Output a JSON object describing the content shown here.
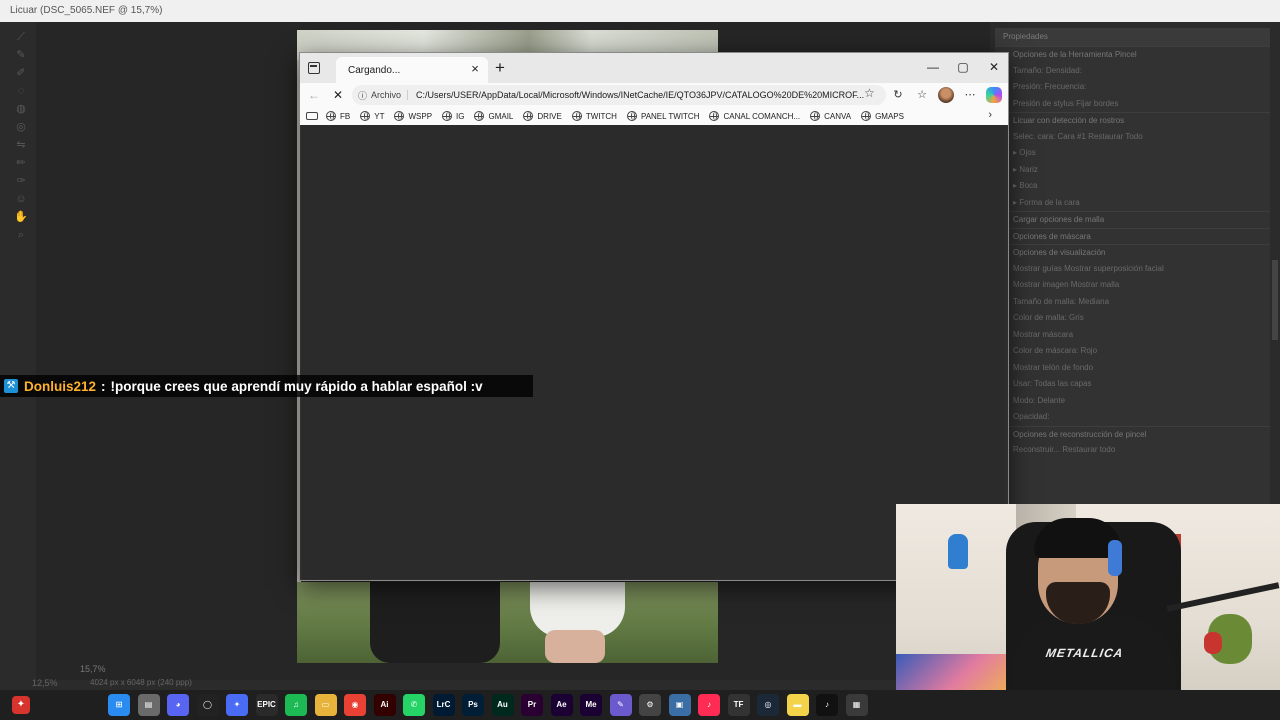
{
  "photoshop": {
    "title": "Licuar (DSC_5065.NEF @ 15,7%)",
    "zoom": "12,5%",
    "zoom_field": "15,7%",
    "doc_info": "4024 px x 6048 px (240 ppp)",
    "panel": {
      "header": "Propiedades",
      "rows": [
        {
          "text": "Opciones de la Herramienta Pincel",
          "section": true
        },
        {
          "text": "Tamaño:            Densidad:",
          "section": false
        },
        {
          "text": "Presión:            Frecuencia:",
          "section": false
        },
        {
          "text": "Presión de stylus                        Fijar bordes",
          "section": false
        },
        {
          "text": "Licuar con detección de rostros",
          "section": true
        },
        {
          "text": "Selec. cara:   Cara #1        Restaurar   Todo",
          "section": false
        },
        {
          "text": "▸ Ojos",
          "section": false
        },
        {
          "text": "▸ Nariz",
          "section": false
        },
        {
          "text": "▸ Boca",
          "section": false
        },
        {
          "text": "▸ Forma de la cara",
          "section": false
        },
        {
          "text": "Cargar opciones de malla",
          "section": true
        },
        {
          "text": "Opciones de máscara",
          "section": true
        },
        {
          "text": "Opciones de visualización",
          "section": true
        },
        {
          "text": "Mostrar guías        Mostrar superposición facial",
          "section": false
        },
        {
          "text": "Mostrar imagen        Mostrar malla",
          "section": false
        },
        {
          "text": "Tamaño de malla:   Mediana",
          "section": false
        },
        {
          "text": "Color de malla:   Gris",
          "section": false
        },
        {
          "text": "Mostrar máscara",
          "section": false
        },
        {
          "text": "Color de máscara:   Rojo",
          "section": false
        },
        {
          "text": "Mostrar telón de fondo",
          "section": false
        },
        {
          "text": "Usar:   Todas las capas",
          "section": false
        },
        {
          "text": "Modo:   Delante",
          "section": false
        },
        {
          "text": "Opacidad:",
          "section": false
        },
        {
          "text": "Opciones de reconstrucción de pincel",
          "section": true
        },
        {
          "text": "Reconstruir...              Restaurar todo",
          "section": false
        }
      ]
    }
  },
  "browser": {
    "tab_title": "Cargando...",
    "url_chip": "Archivo",
    "url": "C:/Users/USER/AppData/Local/Microsoft/Windows/INetCache/IE/QTO36JPV/CATALOGO%20DE%20MICROF...",
    "bookmarks": [
      "FB",
      "YT",
      "WSPP",
      "IG",
      "GMAIL",
      "DRIVE",
      "TWITCH",
      "PANEL TWITCH",
      "CANAL COMANCH...",
      "CANVA",
      "GMAPS"
    ]
  },
  "chat": {
    "username": "Donluis212",
    "separator": ":",
    "message": "!porque crees que aprendí muy rápido a hablar español :v"
  },
  "webcam": {
    "shirt_text": "METALLICA"
  },
  "taskbar": {
    "apps": [
      {
        "name": "windows-start-icon",
        "label": "⊞",
        "color": "#2a8cf0"
      },
      {
        "name": "file-manager-icon",
        "label": "▤",
        "color": "#6a6a6a"
      },
      {
        "name": "discord-icon",
        "label": "◕",
        "color": "#5865f2"
      },
      {
        "name": "obs-icon",
        "label": "◯",
        "color": "#222222"
      },
      {
        "name": "copilot-icon",
        "label": "✦",
        "color": "#4a6cf5"
      },
      {
        "name": "epic-games-icon",
        "label": "EPIC",
        "color": "#2a2a2a"
      },
      {
        "name": "spotify-icon",
        "label": "♫",
        "color": "#1db954"
      },
      {
        "name": "folder-icon",
        "label": "▭",
        "color": "#e8b33a"
      },
      {
        "name": "chrome-icon",
        "label": "◉",
        "color": "#e94235"
      },
      {
        "name": "illustrator-icon",
        "label": "Ai",
        "color": "#330000"
      },
      {
        "name": "whatsapp-icon",
        "label": "✆",
        "color": "#25d366"
      },
      {
        "name": "lightroom-classic-icon",
        "label": "LrC",
        "color": "#001a33"
      },
      {
        "name": "photoshop-icon",
        "label": "Ps",
        "color": "#001e36"
      },
      {
        "name": "audition-icon",
        "label": "Au",
        "color": "#00291d"
      },
      {
        "name": "premiere-icon",
        "label": "Pr",
        "color": "#2a0033"
      },
      {
        "name": "after-effects-icon",
        "label": "Ae",
        "color": "#1a0033"
      },
      {
        "name": "media-encoder-icon",
        "label": "Me",
        "color": "#1a0033"
      },
      {
        "name": "paint-icon",
        "label": "✎",
        "color": "#6a5acd"
      },
      {
        "name": "settings-icon",
        "label": "⚙",
        "color": "#444444"
      },
      {
        "name": "image-viewer-icon",
        "label": "▣",
        "color": "#3a6ea5"
      },
      {
        "name": "tiktok-live-icon",
        "label": "♪",
        "color": "#fe2c55"
      },
      {
        "name": "tf-icon",
        "label": "TF",
        "color": "#333333"
      },
      {
        "name": "steam-icon",
        "label": "◎",
        "color": "#1b2838"
      },
      {
        "name": "sticky-notes-icon",
        "label": "▬",
        "color": "#f3d34a"
      },
      {
        "name": "tiktok-icon",
        "label": "♪",
        "color": "#111111"
      },
      {
        "name": "calculator-icon",
        "label": "▦",
        "color": "#3a3a3a"
      }
    ]
  }
}
